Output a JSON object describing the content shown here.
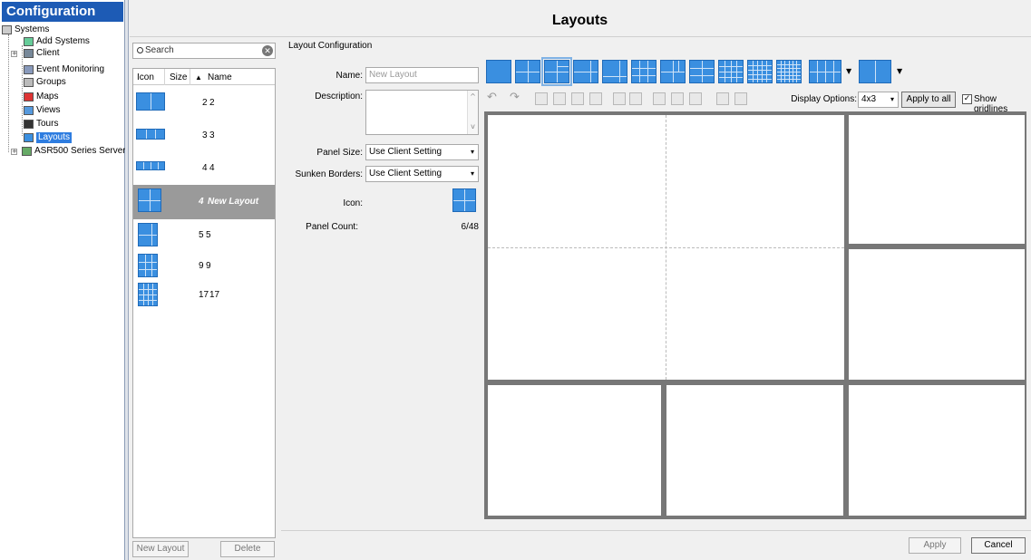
{
  "tree": {
    "header": "Configuration",
    "nodes": [
      "Systems",
      "Add Systems",
      "Client",
      "Event Monitoring",
      "Groups",
      "Maps",
      "Views",
      "Tours",
      "Layouts",
      "ASR500 Series Server"
    ]
  },
  "page": {
    "title": "Layouts"
  },
  "search": {
    "placeholder": "Search"
  },
  "list": {
    "columns": [
      "Icon",
      "Size",
      "Name"
    ],
    "rows": [
      {
        "size": "2",
        "name": "2"
      },
      {
        "size": "3",
        "name": "3"
      },
      {
        "size": "4",
        "name": "4"
      },
      {
        "size": "4",
        "name": "New Layout",
        "selected": true
      },
      {
        "size": "5",
        "name": "5"
      },
      {
        "size": "9",
        "name": "9"
      },
      {
        "size": "17",
        "name": "17"
      }
    ],
    "new_button": "New Layout",
    "delete_button": "Delete"
  },
  "config": {
    "section": "Layout Configuration",
    "name_label": "Name:",
    "name_placeholder": "New Layout",
    "description_label": "Description:",
    "panel_size_label": "Panel Size:",
    "panel_size_value": "Use Client Setting",
    "sunken_borders_label": "Sunken Borders:",
    "sunken_borders_value": "Use Client Setting",
    "icon_label": "Icon:",
    "panel_count_label": "Panel Count:",
    "panel_count_value": "6/48"
  },
  "toolbar": {
    "display_options_label": "Display Options:",
    "display_options_value": "4x3",
    "apply_to_all": "Apply to all",
    "show_gridlines": "Show gridlines",
    "show_gridlines_checked": true
  },
  "footer": {
    "apply": "Apply",
    "cancel": "Cancel"
  },
  "colors": {
    "accent": "#1d5bb5",
    "tile": "#3a8fe0",
    "selection": "#2e7de0"
  }
}
